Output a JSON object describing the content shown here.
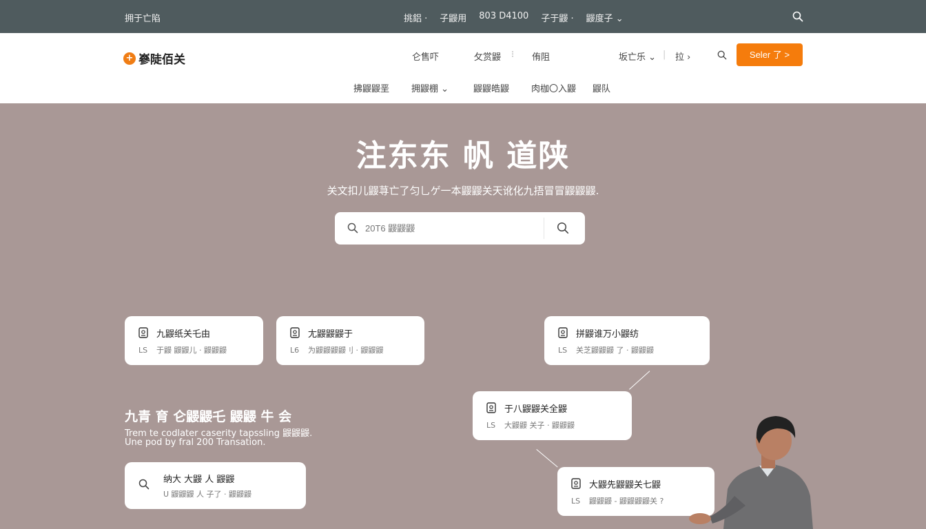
{
  "topbar": {
    "brand": "拥于亡陷",
    "links": [
      "挑鋁 ·",
      "子鼹用",
      "803 D4100",
      "子于鼹 ·",
      "鼹度子 ⌄"
    ]
  },
  "header": {
    "logo_text": "嵾陡佰关",
    "nav_primary": {
      "a": "仑售吓",
      "b": "攵赏鼹",
      "sep": "⁝",
      "c": "侑阻",
      "d": "坂亡乐 ⌄",
      "sep2": "|",
      "e": "拉 ›"
    },
    "cta_label": "Seler 了 >",
    "nav_secondary": [
      "拂鼹鼹垩",
      "拥鼹棚 ⌄",
      "鼹鼹皓鼹",
      "肉枷〇入鼹",
      "鼹队"
    ]
  },
  "hero": {
    "title": "注东东 帆 道陕",
    "subtitle": "关文扣儿鼹荨亡了匀乚ゲ一本鼹鼹关天讹化九捂冒冒鼹鼹鼹.",
    "search_placeholder": "20T6 鼹鼹鼹"
  },
  "cards": [
    {
      "title": "九鼹纸关乇由",
      "ls": "LS",
      "meta": "于鼹 鼹鼹儿 · 鼹鼹鼹"
    },
    {
      "title": "尢鼹鼹鼹于",
      "ls": "L6",
      "meta": "为鼹鼹鼹鼹刂 · 鼹鼹鼹"
    },
    {
      "title": "拼鼹谁万小鼹纺",
      "ls": "LS",
      "meta": "关芝鼹鼹鼹 了 · 鼹鼹鼹"
    },
    {
      "title": "于八鼹鼹关全鼹",
      "ls": "LS",
      "meta": "大鼹鼹 关子 · 鼹鼹鼹"
    },
    {
      "title": "大鼹先鼹鼹关七鼹",
      "ls": "LS",
      "meta": "鼹鼹鼹 - 鼹鼹鼹鼹关 ?"
    }
  ],
  "section": {
    "title": "九青 育 仑鼹鼹乇 鼹鼹 牛 会",
    "desc1": "Trem te codlater caserity tapssling 鼹鼹鼹.",
    "desc2": "Une pod by fral 200 Transation."
  },
  "search_card": {
    "title": "纳大 大鼹 人 鼹鼹",
    "meta": "U 鼹鼹鼹 人 子了 · 鼹鼹鼹"
  },
  "colors": {
    "topbar_bg": "#4f5b5e",
    "accent": "#f57c0c",
    "hero_bg": "#a99896"
  }
}
